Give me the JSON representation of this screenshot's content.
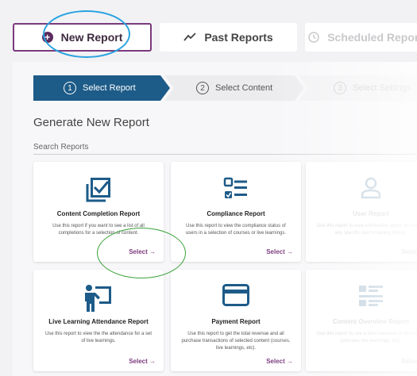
{
  "tabs": [
    {
      "label": "New Report"
    },
    {
      "label": "Past Reports"
    },
    {
      "label": "Scheduled Reports"
    }
  ],
  "stepper": [
    {
      "num": "1",
      "label": "Select Report"
    },
    {
      "num": "2",
      "label": "Select Content"
    },
    {
      "num": "3",
      "label": "Select Settings"
    }
  ],
  "heading": "Generate New Report",
  "search": {
    "label": "Search Reports"
  },
  "cards": [
    {
      "title": "Content Completion Report",
      "desc": "Use this report if you want to see a list of all completions for a selection of content.",
      "select": "Select →",
      "icon": "checklist-icon"
    },
    {
      "title": "Compliance Report",
      "desc": "Use this report to view the compliance status of users in a selection of courses or live learnings.",
      "select": "Select →",
      "icon": "list-check-icon"
    },
    {
      "title": "User Report",
      "desc": "Use this report to view information about all content any specific user's training history.",
      "select": "Select →",
      "icon": "user-icon"
    },
    {
      "title": "Live Learning Attendance Report",
      "desc": "Use this report to view the the attendance for a set of live learnings.",
      "select": "Select →",
      "icon": "presenter-icon"
    },
    {
      "title": "Payment Report",
      "desc": "Use this report to get the total revenue and all purchase transactions of selected content (courses, live learnings, etc).",
      "select": "Select →",
      "icon": "credit-card-icon"
    },
    {
      "title": "Content Overview Report",
      "desc": "Use this report to see a brief overview of all content (courses, live learnings, etc).",
      "select": "Select →",
      "icon": "overview-list-icon"
    }
  ],
  "colors": {
    "accent": "#7b3a7e",
    "stepper_active": "#1d5b88",
    "icon_blue": "#1d5b88",
    "annotation_blue": "#2aa3e0",
    "annotation_green": "#3aa23a"
  }
}
